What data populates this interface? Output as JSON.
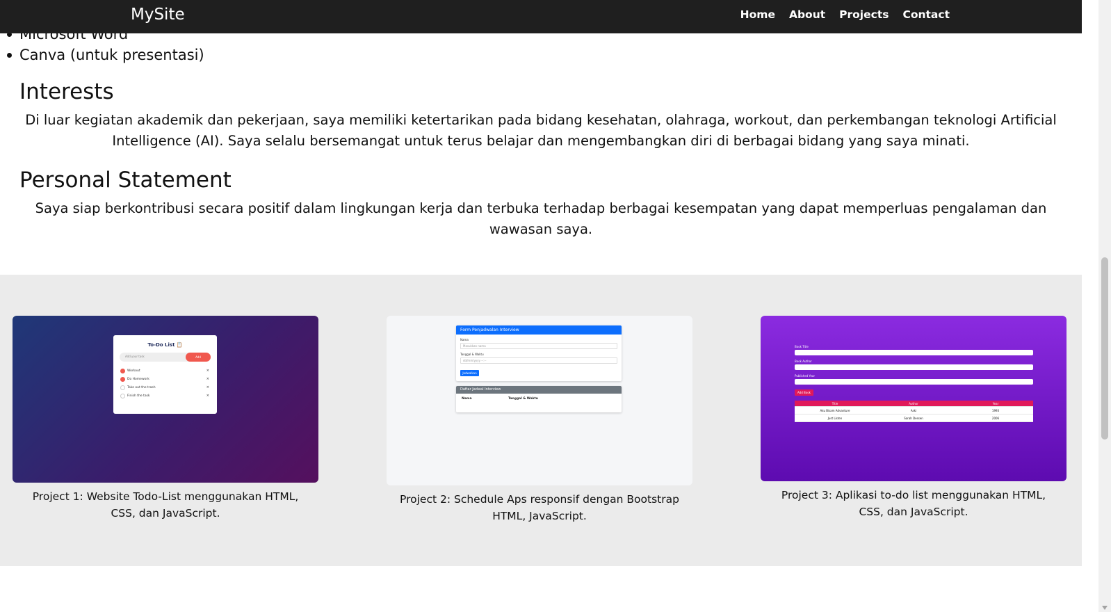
{
  "nav": {
    "brand": "MySite",
    "links": [
      "Home",
      "About",
      "Projects",
      "Contact"
    ]
  },
  "skills": {
    "items": [
      "Microsoft Word",
      "Canva (untuk presentasi)"
    ]
  },
  "interests": {
    "title": "Interests",
    "text_line1": "Di luar kegiatan akademik dan pekerjaan, saya memiliki ketertarikan pada bidang kesehatan, olahraga, workout, dan perkembangan teknologi Artificial",
    "text_line2": "Intelligence (AI). Saya selalu bersemangat untuk terus belajar dan mengembangkan diri di berbagai bidang yang saya minati."
  },
  "statement": {
    "title": "Personal Statement",
    "text_line1": "Saya siap berkontribusi secara positif dalam lingkungan kerja dan terbuka terhadap berbagai kesempatan yang dapat memperluas pengalaman dan",
    "text_line2": "wawasan saya."
  },
  "projects": [
    {
      "caption": "Project 1: Website Todo-List menggunakan HTML, CSS, dan JavaScript.",
      "preview": {
        "title": "To-Do List 📋",
        "placeholder": "Add your task",
        "add": "Add",
        "items": [
          {
            "text": "Workout",
            "done": true
          },
          {
            "text": "Do Homework",
            "done": true
          },
          {
            "text": "Take out the trash",
            "done": false
          },
          {
            "text": "Finish the task",
            "done": false
          }
        ],
        "remove": "×"
      }
    },
    {
      "caption": "Project 2: Schedule Aps responsif dengan Bootstrap HTML, JavaScript.",
      "preview": {
        "form_title": "Form Penjadwalan Interview",
        "name_label": "Nama",
        "name_placeholder": "Masukkan nama",
        "date_label": "Tanggal & Waktu",
        "date_placeholder": "dd/mm/yyyy --:--",
        "submit": "Jadwalkan",
        "list_title": "Daftar Jadwal Interview",
        "col_name": "Nama",
        "col_date": "Tanggal & Waktu"
      }
    },
    {
      "caption": "Project 3: Aplikasi to-do list menggunakan HTML, CSS, dan JavaScript.",
      "preview": {
        "label_title": "Book Title",
        "label_author": "Book Author",
        "label_year": "Published Year",
        "add": "Add Book",
        "headers": [
          "Title",
          "Author",
          "Year"
        ],
        "rows": [
          [
            "Aku Bisam Advanture",
            "Aski",
            "1993"
          ],
          [
            "Just Listen",
            "Sarah Dessen",
            "2006"
          ]
        ]
      }
    }
  ]
}
